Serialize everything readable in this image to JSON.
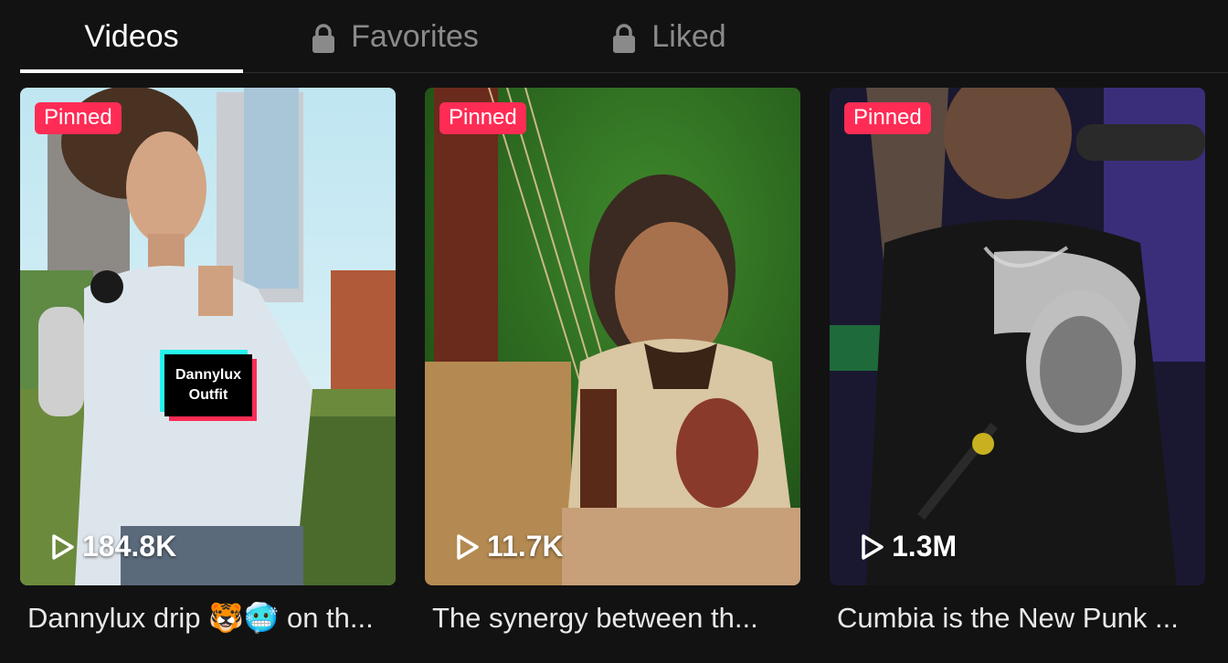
{
  "tabs": [
    {
      "label": "Videos",
      "locked": false,
      "active": true
    },
    {
      "label": "Favorites",
      "locked": true,
      "active": false
    },
    {
      "label": "Liked",
      "locked": true,
      "active": false
    }
  ],
  "videos": [
    {
      "pinned_label": "Pinned",
      "plays": "184.8K",
      "caption": "Dannylux drip 🐯🥶 on th...",
      "overlay_text_line1": "Dannylux",
      "overlay_text_line2": "Outfit"
    },
    {
      "pinned_label": "Pinned",
      "plays": "11.7K",
      "caption": "The synergy between th..."
    },
    {
      "pinned_label": "Pinned",
      "plays": "1.3M",
      "caption": "Cumbia is the New Punk ..."
    }
  ],
  "colors": {
    "background": "#121212",
    "pinned_badge": "#fe2c55",
    "inactive_tab": "#8a8a8a",
    "active_tab": "#ffffff"
  }
}
